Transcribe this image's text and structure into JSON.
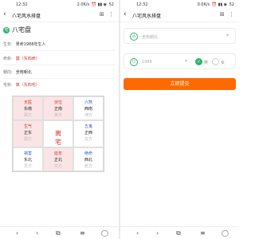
{
  "left_screen": {
    "status": {
      "time": "12:32",
      "net": "2.0K/s",
      "icons": "⏰ ▮▮ ◉",
      "battery": "52"
    },
    "header": {
      "back": "‹",
      "title": "八宅风水排盘",
      "icon1": "⊞",
      "icon2": "⋮"
    },
    "section_title": "八宅盘",
    "section_icon": "宅",
    "info": [
      {
        "label": "生年:",
        "value": "男命1988年生人",
        "accent": false
      },
      {
        "label": "命卦:",
        "value": "震（东四命）",
        "accent": true
      },
      {
        "label": "朝向:",
        "value": "坐南朝北",
        "accent": false
      },
      {
        "label": "宅卦:",
        "value": "离（东四宅）",
        "accent": true
      }
    ],
    "grid": [
      {
        "star": "天医",
        "dir": "东南",
        "sub": "巽方",
        "bg": "pink",
        "star_color": "red"
      },
      {
        "star": "伏位",
        "dir": "正南",
        "sub": "离方",
        "bg": "pink",
        "star_color": "red"
      },
      {
        "star": "六煞",
        "dir": "西南",
        "sub": "坤方",
        "bg": "white",
        "star_color": "blue"
      },
      {
        "star": "生气",
        "dir": "正东",
        "sub": "震方",
        "bg": "pink",
        "star_color": "red"
      },
      {
        "center": [
          "离",
          "宅"
        ]
      },
      {
        "star": "五鬼",
        "dir": "正西",
        "sub": "兑方",
        "bg": "white",
        "star_color": "blue"
      },
      {
        "star": "祸害",
        "dir": "东北",
        "sub": "艮方",
        "bg": "white",
        "star_color": "blue"
      },
      {
        "star": "延年",
        "dir": "正北",
        "sub": "坎方",
        "bg": "pink",
        "star_color": "red"
      },
      {
        "star": "绝命",
        "dir": "西北",
        "sub": "乾方",
        "bg": "white",
        "star_color": "blue"
      }
    ],
    "nav": [
      "‹",
      "›",
      "⧉",
      "≡",
      "◯"
    ]
  },
  "right_screen": {
    "status": {
      "time": "12:32",
      "net": "0.0K/s",
      "icons": "⏰ ▮▮ ◉",
      "battery": "52"
    },
    "header": {
      "back": "‹",
      "title": "八宅风水排盘",
      "icon1": "⊞",
      "icon2": "⋮"
    },
    "orientation": {
      "icon": "⌂",
      "placeholder": "坐南朝北",
      "chevron": "▾"
    },
    "birth": {
      "icon": "⚇",
      "placeholder": "1988",
      "chevron": "▾",
      "male_label": "男",
      "female_label": "女",
      "check": "✓"
    },
    "submit_label": "立即提交",
    "nav": [
      "‹",
      "›",
      "⧉",
      "≡",
      "◯"
    ]
  },
  "colors": {
    "accent": "#ff6a00",
    "green": "#2db46a",
    "red": "#d0342c",
    "blue": "#2d62c9",
    "pink": "#fbe4e6"
  }
}
